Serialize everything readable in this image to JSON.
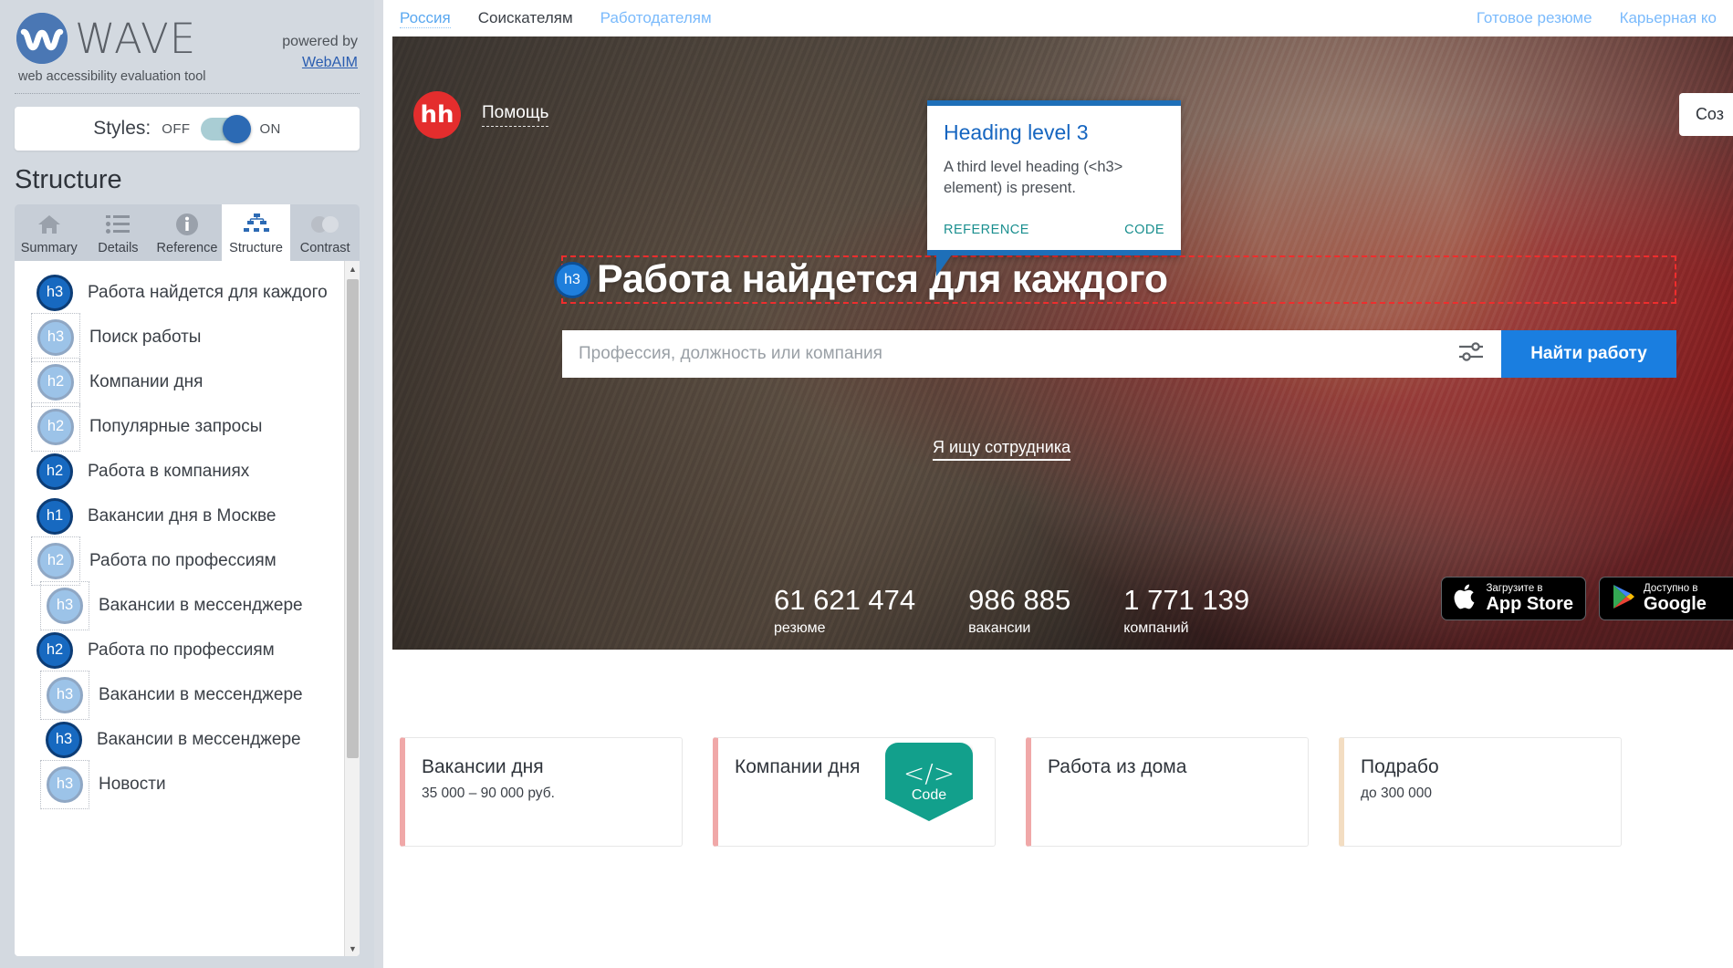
{
  "wave": {
    "brand": "WAVE",
    "tagline": "web accessibility evaluation tool",
    "powered_by": "powered by",
    "powered_link": "WebAIM",
    "styles_label": "Styles:",
    "styles_off": "OFF",
    "styles_on": "ON",
    "panel_title": "Structure",
    "tabs": [
      {
        "label": "Summary",
        "icon": "home-icon",
        "active": false
      },
      {
        "label": "Details",
        "icon": "list-icon",
        "active": false
      },
      {
        "label": "Reference",
        "icon": "info-icon",
        "active": false
      },
      {
        "label": "Structure",
        "icon": "structure-icon",
        "active": true
      },
      {
        "label": "Contrast",
        "icon": "contrast-icon",
        "active": false
      }
    ],
    "structure_items": [
      {
        "level": "h3",
        "label": "Работа найдется для каждого",
        "dark": true,
        "indent": 0,
        "boxed": false
      },
      {
        "level": "h3",
        "label": "Поиск работы",
        "dark": false,
        "indent": 0,
        "boxed": true
      },
      {
        "level": "h2",
        "label": "Компании дня",
        "dark": false,
        "indent": 0,
        "boxed": true
      },
      {
        "level": "h2",
        "label": "Популярные запросы",
        "dark": false,
        "indent": 0,
        "boxed": true
      },
      {
        "level": "h2",
        "label": "Работа в компаниях",
        "dark": true,
        "indent": 0,
        "boxed": false
      },
      {
        "level": "h1",
        "label": "Вакансии дня в Москве",
        "dark": true,
        "indent": 0,
        "boxed": false
      },
      {
        "level": "h2",
        "label": "Работа по профессиям",
        "dark": false,
        "indent": 0,
        "boxed": true
      },
      {
        "level": "h3",
        "label": "Вакансии в мессенджере",
        "dark": false,
        "indent": 1,
        "boxed": true
      },
      {
        "level": "h2",
        "label": "Работа по профессиям",
        "dark": true,
        "indent": 0,
        "boxed": false
      },
      {
        "level": "h3",
        "label": "Вакансии в мессенджере",
        "dark": false,
        "indent": 1,
        "boxed": true
      },
      {
        "level": "h3",
        "label": "Вакансии в мессенджере",
        "dark": true,
        "indent": 1,
        "boxed": false
      },
      {
        "level": "h3",
        "label": "Новости",
        "dark": false,
        "indent": 1,
        "boxed": true
      }
    ],
    "popup": {
      "title": "Heading level 3",
      "description": "A third level heading (<h3> element) is present.",
      "reference_label": "REFERENCE",
      "code_label": "CODE"
    },
    "colors": {
      "panel_bg": "#d3d9e0",
      "accent_blue": "#2c6ab4",
      "badge_light": "#9cc3e8",
      "badge_dark": "#1769c0",
      "popup_border": "#1e6fb8",
      "popup_link": "#1a8f8f",
      "highlight_outline": "#ef2d2d"
    }
  },
  "hh": {
    "topnav_left": [
      "Россия",
      "Соискателям",
      "Работодателям"
    ],
    "topnav_right": [
      "Готовое резюме",
      "Карьерная ко"
    ],
    "logo_text": "hh",
    "help_label": "Помощь",
    "cos_label": "Соз",
    "hero_heading": "Работа найдется для каждого",
    "heading_marker": "h3",
    "search_placeholder": "Профессия, должность или компания",
    "search_button": "Найти работу",
    "employer_link": "Я ищу сотрудника",
    "stats": [
      {
        "value": "61 621 474",
        "caption": "резюме"
      },
      {
        "value": "986 885",
        "caption": "вакансии"
      },
      {
        "value": "1 771 139",
        "caption": "компаний"
      }
    ],
    "store_badges": [
      {
        "small": "Загрузите в",
        "big": "App Store",
        "icon": "apple-icon"
      },
      {
        "small": "Доступно в",
        "big": "Google",
        "icon": "google-play-icon"
      }
    ],
    "cards": [
      {
        "title": "Вакансии дня",
        "subtitle": "35 000 – 90 000 руб.",
        "accent": "#f0a8a8",
        "code_badge": false
      },
      {
        "title": "Компании дня",
        "subtitle": "",
        "accent": "#f0a8a8",
        "code_badge": true
      },
      {
        "title": "Работа из дома",
        "subtitle": "",
        "accent": "#f0a8a8",
        "code_badge": false
      },
      {
        "title": "Подрабо",
        "subtitle": "до 300 000",
        "accent": "#f3ddc2",
        "code_badge": false
      }
    ],
    "code_badge": {
      "glyph": "</>",
      "label": "Code"
    }
  }
}
